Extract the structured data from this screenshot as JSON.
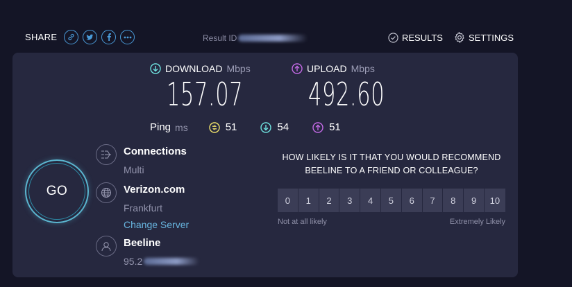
{
  "header": {
    "share_label": "SHARE",
    "share_icons": [
      "link-icon",
      "twitter-icon",
      "facebook-icon",
      "more-icon"
    ],
    "result_id_label": "Result ID",
    "results_label": "RESULTS",
    "settings_label": "SETTINGS"
  },
  "download": {
    "label": "DOWNLOAD",
    "unit": "Mbps",
    "value": "157.07",
    "color": "#6fe3e0"
  },
  "upload": {
    "label": "UPLOAD",
    "unit": "Mbps",
    "value": "492.60",
    "color": "#c46ae6"
  },
  "ping": {
    "label": "Ping",
    "unit": "ms",
    "idle": "51",
    "download": "54",
    "upload": "51",
    "idle_color": "#f1e36b"
  },
  "go_label": "GO",
  "connections": {
    "title": "Connections",
    "value": "Multi"
  },
  "server": {
    "name": "Verizon.com",
    "location": "Frankfurt",
    "change_label": "Change Server"
  },
  "isp": {
    "name": "Beeline",
    "ip": "95.2"
  },
  "survey": {
    "question_line1": "HOW LIKELY IS IT THAT YOU WOULD RECOMMEND",
    "question_line2": "BEELINE TO A FRIEND OR COLLEAGUE?",
    "scale": [
      "0",
      "1",
      "2",
      "3",
      "4",
      "5",
      "6",
      "7",
      "8",
      "9",
      "10"
    ],
    "low_label": "Not at all likely",
    "high_label": "Extremely Likely"
  }
}
